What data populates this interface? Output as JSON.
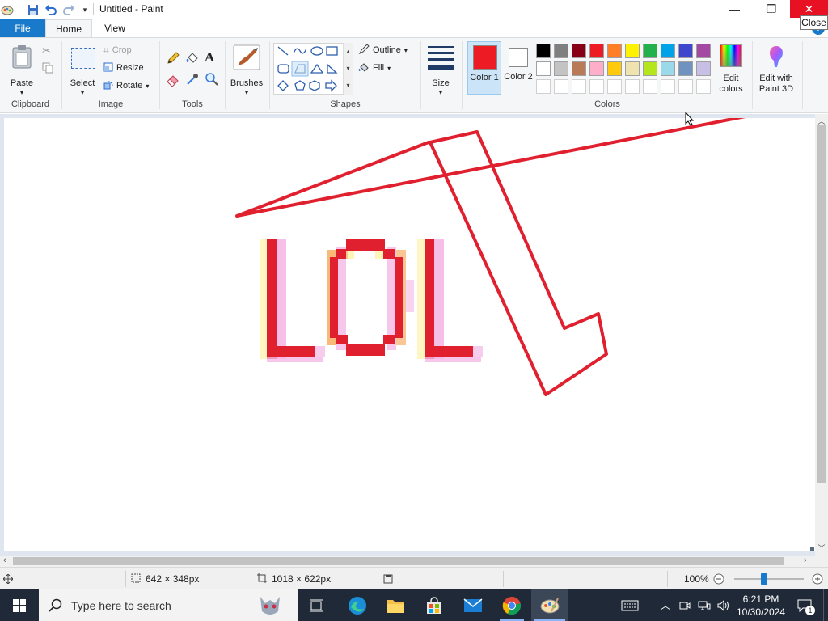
{
  "window": {
    "title": "Untitled - Paint",
    "close_tooltip": "Close",
    "minimize_glyph": "—",
    "restore_glyph": "❐",
    "close_glyph": "✕"
  },
  "tabs": [
    {
      "label": "File"
    },
    {
      "label": "Home"
    },
    {
      "label": "View"
    }
  ],
  "ribbon": {
    "clipboard": {
      "group_label": "Clipboard",
      "paste_label": "Paste"
    },
    "image": {
      "group_label": "Image",
      "select_label": "Select",
      "crop_label": "Crop",
      "resize_label": "Resize",
      "rotate_label": "Rotate"
    },
    "tools": {
      "group_label": "Tools"
    },
    "brushes": {
      "label": "Brushes"
    },
    "shapes": {
      "group_label": "Shapes",
      "outline_label": "Outline",
      "fill_label": "Fill"
    },
    "size": {
      "label": "Size"
    },
    "colors": {
      "group_label": "Colors",
      "color1_label": "Color 1",
      "color2_label": "Color 2",
      "color1_value": "#ed1c24",
      "color2_value": "#ffffff",
      "edit_colors_label": "Edit colors",
      "palette_row1": [
        "#000000",
        "#7f7f7f",
        "#880015",
        "#ed1c24",
        "#ff7f27",
        "#fff200",
        "#22b14c",
        "#00a2e8",
        "#3f48cc",
        "#a349a4"
      ],
      "palette_row2": [
        "#ffffff",
        "#c3c3c3",
        "#b97a57",
        "#ffaec9",
        "#ffc90e",
        "#efe4b0",
        "#b5e61d",
        "#99d9ea",
        "#7092be",
        "#c8bfe7"
      ]
    },
    "paint3d": {
      "label": "Edit with Paint 3D"
    }
  },
  "status": {
    "selection_size": "642 × 348px",
    "image_size": "1018 × 622px",
    "zoom": "100%",
    "zoom_level": 1.0
  },
  "taskbar": {
    "search_placeholder": "Type here to search",
    "time": "6:21 PM",
    "date": "10/30/2024",
    "notification_count": "1"
  },
  "canvas": {
    "text_drawn": "LOL",
    "stroke_color": "#e0202e"
  }
}
